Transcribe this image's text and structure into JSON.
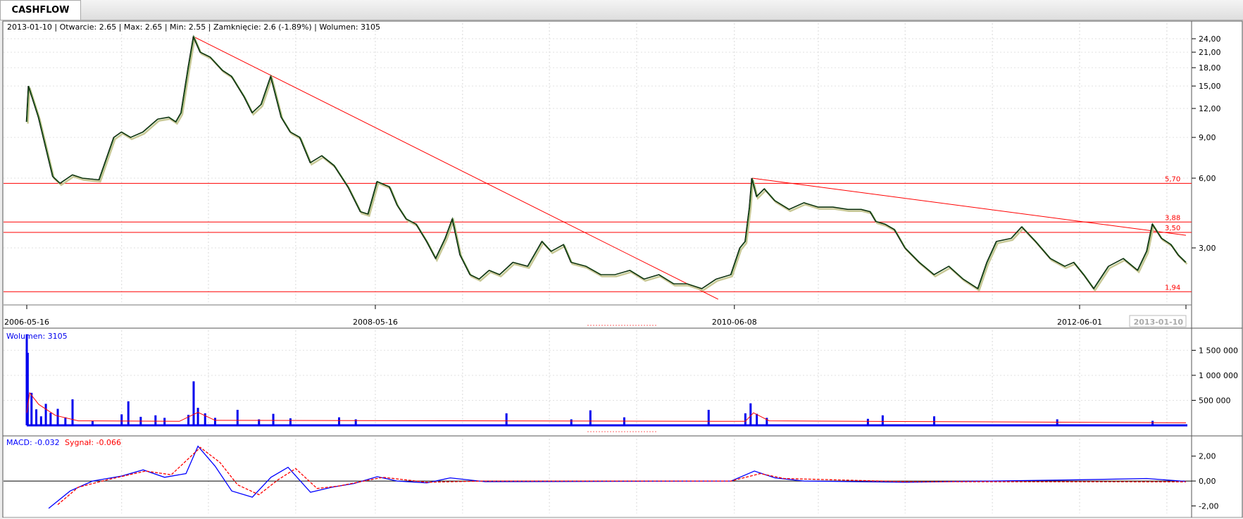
{
  "tab": {
    "label": "CASHFLOW"
  },
  "info": {
    "date": "2013-01-10",
    "open": "Otwarcie: 2.65",
    "max": "Max: 2.65",
    "min": "Min: 2.55",
    "close": "Zamknięcie: 2.6 (-1.89%)",
    "volume": "Wolumen: 3105"
  },
  "colors": {
    "price": "#1e5a1e",
    "shadow": "#c8c896",
    "resistance": "#ff0000",
    "volume": "#0000ee",
    "macd": "#0000ff",
    "signal": "#ff0000"
  },
  "chart_data": [
    {
      "type": "line",
      "scale": "log",
      "ylim": [
        1.75,
        28
      ],
      "x_axis_labels": [
        "2006-05-16",
        "2008-05-16",
        "2010-06-08",
        "2012-06-01",
        "2013-01-10"
      ],
      "y_ticks": [
        "24,00",
        "21,00",
        "18,00",
        "15,00",
        "12,00",
        "9,00",
        "6,00",
        "3,00"
      ],
      "horizontal_levels": [
        {
          "label": "5,70",
          "value": 5.7
        },
        {
          "label": "3,88",
          "value": 3.88
        },
        {
          "label": "3,50",
          "value": 3.5
        },
        {
          "label": "1,94",
          "value": 1.94
        }
      ],
      "trend_lines": [
        {
          "from": [
            "2007-05-01",
            24.5
          ],
          "to": [
            "2010-05-05",
            1.8
          ]
        },
        {
          "from": [
            "2010-07-15",
            6.0
          ],
          "to": [
            "2013-01-10",
            3.4
          ]
        }
      ],
      "series": [
        {
          "dates": [
            "2006-05-16",
            "2006-05-20",
            "2006-06-10",
            "2006-07-10",
            "2006-07-25",
            "2006-08-20",
            "2006-09-10",
            "2006-10-15",
            "2006-11-15",
            "2006-12-01",
            "2006-12-20",
            "2007-01-15",
            "2007-02-15",
            "2007-03-10",
            "2007-03-25",
            "2007-04-05",
            "2007-04-20",
            "2007-05-01",
            "2007-05-15",
            "2007-06-05",
            "2007-07-01",
            "2007-07-20",
            "2007-08-15",
            "2007-09-01",
            "2007-09-20",
            "2007-10-10",
            "2007-11-01",
            "2007-11-20",
            "2007-12-10",
            "2008-01-01",
            "2008-01-25",
            "2008-02-20",
            "2008-03-20",
            "2008-04-15",
            "2008-05-01",
            "2008-05-20",
            "2008-06-15",
            "2008-07-01",
            "2008-07-20",
            "2008-08-10",
            "2008-09-01",
            "2008-09-20",
            "2008-10-10",
            "2008-10-25",
            "2008-11-10",
            "2008-12-01",
            "2008-12-20",
            "2009-01-10",
            "2009-02-01",
            "2009-03-01",
            "2009-04-01",
            "2009-05-01",
            "2009-05-20",
            "2009-06-15",
            "2009-07-01",
            "2009-08-01",
            "2009-09-01",
            "2009-10-01",
            "2009-11-01",
            "2009-12-01",
            "2010-01-01",
            "2010-02-01",
            "2010-03-01",
            "2010-04-01",
            "2010-05-01",
            "2010-06-01",
            "2010-06-20",
            "2010-07-01",
            "2010-07-10",
            "2010-07-15",
            "2010-07-25",
            "2010-08-10",
            "2010-09-01",
            "2010-10-01",
            "2010-11-01",
            "2010-12-01",
            "2011-01-01",
            "2011-02-01",
            "2011-03-01",
            "2011-03-20",
            "2011-04-01",
            "2011-04-20",
            "2011-05-10",
            "2011-06-01",
            "2011-07-01",
            "2011-08-01",
            "2011-09-01",
            "2011-10-01",
            "2011-11-01",
            "2011-11-20",
            "2011-12-10",
            "2012-01-10",
            "2012-02-01",
            "2012-03-01",
            "2012-04-01",
            "2012-05-01",
            "2012-05-20",
            "2012-06-10",
            "2012-07-01",
            "2012-08-01",
            "2012-09-01",
            "2012-10-01",
            "2012-10-20",
            "2012-11-01",
            "2012-11-20",
            "2012-12-10",
            "2012-12-25",
            "2013-01-10"
          ],
          "values": [
            10.5,
            15.0,
            11.0,
            6.1,
            5.7,
            6.2,
            6.0,
            5.9,
            9.0,
            9.5,
            9.0,
            9.5,
            10.8,
            11.0,
            10.5,
            11.5,
            18.0,
            24.5,
            21.0,
            20.0,
            17.5,
            16.5,
            13.5,
            11.5,
            12.5,
            16.5,
            11.0,
            9.5,
            9.0,
            7.0,
            7.5,
            6.8,
            5.5,
            4.3,
            4.2,
            5.8,
            5.5,
            4.6,
            4.0,
            3.8,
            3.2,
            2.7,
            3.3,
            4.0,
            2.8,
            2.3,
            2.2,
            2.4,
            2.3,
            2.6,
            2.5,
            3.2,
            2.9,
            3.1,
            2.6,
            2.5,
            2.3,
            2.3,
            2.4,
            2.2,
            2.3,
            2.1,
            2.1,
            2.0,
            2.2,
            2.3,
            3.0,
            3.2,
            4.5,
            6.0,
            5.0,
            5.4,
            4.8,
            4.4,
            4.7,
            4.5,
            4.5,
            4.4,
            4.4,
            4.3,
            3.9,
            3.8,
            3.6,
            3.0,
            2.6,
            2.3,
            2.5,
            2.2,
            2.0,
            2.6,
            3.2,
            3.3,
            3.7,
            3.2,
            2.7,
            2.5,
            2.6,
            2.3,
            2.0,
            2.5,
            2.7,
            2.4,
            2.9,
            3.8,
            3.3,
            3.1,
            2.8,
            2.6
          ]
        }
      ]
    },
    {
      "type": "bar",
      "title": "Wolumen: 3105",
      "ylim": [
        0,
        1900000
      ],
      "y_ticks": [
        "1 500 000",
        "1 000 000",
        "500 000"
      ],
      "bars": [
        {
          "date": "2006-05-16",
          "value": 1820000
        },
        {
          "date": "2006-05-18",
          "value": 1450000
        },
        {
          "date": "2006-05-26",
          "value": 650000
        },
        {
          "date": "2006-06-05",
          "value": 320000
        },
        {
          "date": "2006-06-15",
          "value": 180000
        },
        {
          "date": "2006-06-25",
          "value": 430000
        },
        {
          "date": "2006-07-05",
          "value": 250000
        },
        {
          "date": "2006-07-20",
          "value": 330000
        },
        {
          "date": "2006-08-05",
          "value": 160000
        },
        {
          "date": "2006-08-20",
          "value": 520000
        },
        {
          "date": "2006-10-01",
          "value": 90000
        },
        {
          "date": "2006-12-01",
          "value": 220000
        },
        {
          "date": "2006-12-15",
          "value": 480000
        },
        {
          "date": "2007-01-10",
          "value": 170000
        },
        {
          "date": "2007-02-10",
          "value": 200000
        },
        {
          "date": "2007-03-01",
          "value": 150000
        },
        {
          "date": "2007-04-20",
          "value": 210000
        },
        {
          "date": "2007-05-01",
          "value": 880000
        },
        {
          "date": "2007-05-10",
          "value": 350000
        },
        {
          "date": "2007-05-25",
          "value": 240000
        },
        {
          "date": "2007-06-15",
          "value": 150000
        },
        {
          "date": "2007-08-01",
          "value": 310000
        },
        {
          "date": "2007-09-15",
          "value": 120000
        },
        {
          "date": "2007-10-15",
          "value": 230000
        },
        {
          "date": "2007-11-20",
          "value": 140000
        },
        {
          "date": "2008-03-01",
          "value": 160000
        },
        {
          "date": "2008-04-05",
          "value": 120000
        },
        {
          "date": "2009-02-15",
          "value": 240000
        },
        {
          "date": "2009-07-01",
          "value": 120000
        },
        {
          "date": "2009-08-10",
          "value": 300000
        },
        {
          "date": "2009-10-20",
          "value": 160000
        },
        {
          "date": "2010-04-15",
          "value": 310000
        },
        {
          "date": "2010-07-01",
          "value": 240000
        },
        {
          "date": "2010-07-12",
          "value": 440000
        },
        {
          "date": "2010-07-25",
          "value": 230000
        },
        {
          "date": "2010-08-15",
          "value": 150000
        },
        {
          "date": "2011-03-15",
          "value": 130000
        },
        {
          "date": "2011-04-15",
          "value": 200000
        },
        {
          "date": "2011-08-01",
          "value": 180000
        },
        {
          "date": "2012-04-15",
          "value": 120000
        },
        {
          "date": "2012-11-01",
          "value": 90000
        }
      ],
      "moving_average": [
        {
          "date": "2006-05-16",
          "value": 250000
        },
        {
          "date": "2006-05-22",
          "value": 650000
        },
        {
          "date": "2006-06-10",
          "value": 420000
        },
        {
          "date": "2006-07-15",
          "value": 200000
        },
        {
          "date": "2006-09-01",
          "value": 90000
        },
        {
          "date": "2007-04-01",
          "value": 80000
        },
        {
          "date": "2007-05-10",
          "value": 260000
        },
        {
          "date": "2007-06-15",
          "value": 100000
        },
        {
          "date": "2010-07-01",
          "value": 80000
        },
        {
          "date": "2010-07-18",
          "value": 250000
        },
        {
          "date": "2010-08-20",
          "value": 90000
        },
        {
          "date": "2013-01-10",
          "value": 50000
        }
      ]
    },
    {
      "type": "line",
      "title": "MACD: -0.032",
      "signal_label": "Sygnał: -0.066",
      "ylim": [
        -2.6,
        3.4
      ],
      "y_ticks": [
        "2,00",
        "0,00",
        "-2,00"
      ],
      "series": [
        {
          "name": "MACD",
          "dates": [
            "2006-07-01",
            "2006-08-15",
            "2006-10-01",
            "2006-12-01",
            "2007-01-15",
            "2007-03-01",
            "2007-04-15",
            "2007-05-10",
            "2007-06-15",
            "2007-07-20",
            "2007-09-01",
            "2007-10-10",
            "2007-11-15",
            "2008-01-01",
            "2008-02-15",
            "2008-04-01",
            "2008-05-20",
            "2008-07-01",
            "2008-09-01",
            "2008-10-20",
            "2009-01-01",
            "2010-06-01",
            "2010-07-20",
            "2010-09-01",
            "2010-11-01",
            "2011-06-01",
            "2012-06-01",
            "2012-10-20",
            "2013-01-10"
          ],
          "values": [
            -2.2,
            -0.8,
            0.0,
            0.4,
            0.9,
            0.3,
            0.6,
            2.8,
            1.2,
            -0.8,
            -1.3,
            0.3,
            1.1,
            -0.9,
            -0.5,
            -0.2,
            0.35,
            0.0,
            -0.15,
            0.25,
            -0.05,
            0.0,
            0.8,
            0.25,
            0.0,
            -0.1,
            0.1,
            0.2,
            -0.03
          ]
        },
        {
          "name": "Sygnał",
          "dates": [
            "2006-07-20",
            "2006-09-01",
            "2006-11-01",
            "2007-01-20",
            "2007-03-15",
            "2007-05-15",
            "2007-06-25",
            "2007-08-01",
            "2007-09-15",
            "2007-10-25",
            "2007-12-01",
            "2008-01-15",
            "2008-03-01",
            "2008-06-01",
            "2008-09-01",
            "2009-01-01",
            "2010-06-01",
            "2010-08-01",
            "2010-09-20",
            "2011-06-01",
            "2013-01-10"
          ],
          "values": [
            -1.9,
            -0.5,
            0.1,
            0.8,
            0.5,
            2.7,
            1.5,
            -0.3,
            -1.1,
            0.1,
            1.0,
            -0.6,
            -0.4,
            0.3,
            -0.1,
            0.0,
            0.0,
            0.6,
            0.2,
            -0.05,
            -0.066
          ]
        }
      ]
    }
  ]
}
